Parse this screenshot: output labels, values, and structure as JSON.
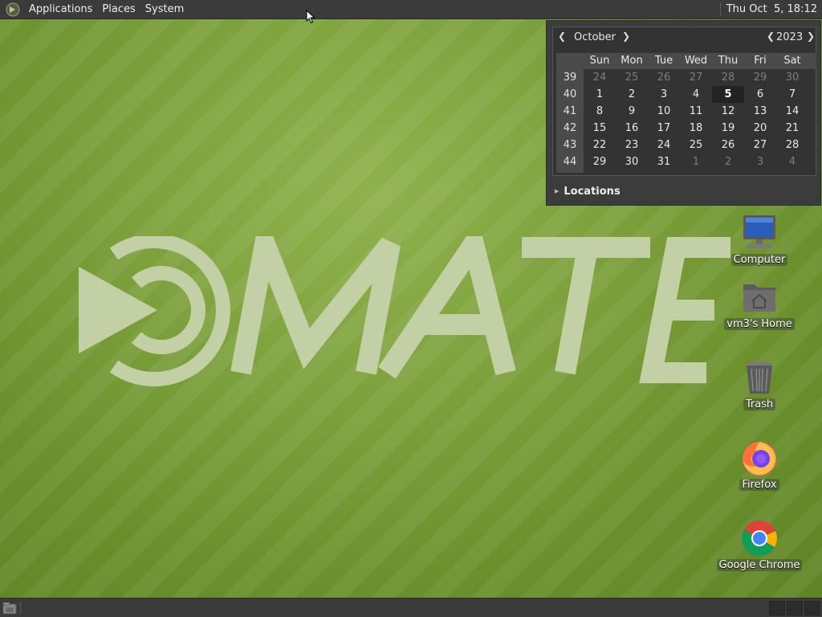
{
  "top_panel": {
    "menus": [
      "Applications",
      "Places",
      "System"
    ],
    "clock": "Thu Oct  5, 18:12"
  },
  "calendar": {
    "month": "October",
    "year": "2023",
    "day_names": [
      "Sun",
      "Mon",
      "Tue",
      "Wed",
      "Thu",
      "Fri",
      "Sat"
    ],
    "weeks": [
      {
        "week": "39",
        "days": [
          "24",
          "25",
          "26",
          "27",
          "28",
          "29",
          "30"
        ]
      },
      {
        "week": "40",
        "days": [
          "1",
          "2",
          "3",
          "4",
          "5",
          "6",
          "7"
        ]
      },
      {
        "week": "41",
        "days": [
          "8",
          "9",
          "10",
          "11",
          "12",
          "13",
          "14"
        ]
      },
      {
        "week": "42",
        "days": [
          "15",
          "16",
          "17",
          "18",
          "19",
          "20",
          "21"
        ]
      },
      {
        "week": "43",
        "days": [
          "22",
          "23",
          "24",
          "25",
          "26",
          "27",
          "28"
        ]
      },
      {
        "week": "44",
        "days": [
          "29",
          "30",
          "31",
          "1",
          "2",
          "3",
          "4"
        ]
      }
    ],
    "today": "5",
    "locations_label": "Locations"
  },
  "desktop_icons": [
    {
      "label": "Computer",
      "icon": "computer-icon"
    },
    {
      "label": "vm3's Home",
      "icon": "home-folder-icon"
    },
    {
      "label": "Trash",
      "icon": "trash-icon"
    },
    {
      "label": "Firefox",
      "icon": "firefox-icon"
    },
    {
      "label": "Google Chrome",
      "icon": "chrome-icon"
    }
  ],
  "colors": {
    "panel": "#3b3b3b",
    "wallpaper_green": "#7ea23d",
    "logo_tint": "#c3d0a6"
  }
}
